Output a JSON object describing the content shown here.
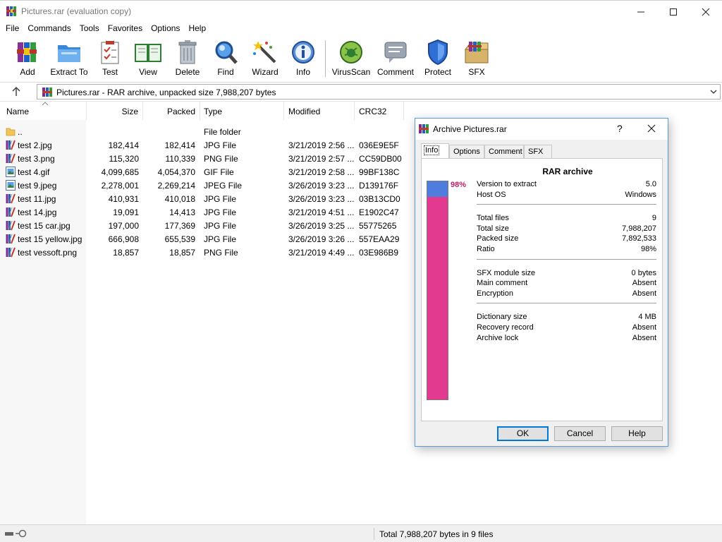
{
  "window": {
    "title": "Pictures.rar (evaluation copy)"
  },
  "menu": [
    "File",
    "Commands",
    "Tools",
    "Favorites",
    "Options",
    "Help"
  ],
  "toolbar": [
    {
      "label": "Add",
      "icon": "add-icon"
    },
    {
      "label": "Extract To",
      "icon": "extract-to-icon"
    },
    {
      "label": "Test",
      "icon": "test-icon"
    },
    {
      "label": "View",
      "icon": "view-icon"
    },
    {
      "label": "Delete",
      "icon": "delete-icon"
    },
    {
      "label": "Find",
      "icon": "find-icon"
    },
    {
      "label": "Wizard",
      "icon": "wizard-icon"
    },
    {
      "label": "Info",
      "icon": "info-icon"
    },
    {
      "label": "VirusScan",
      "icon": "virus-scan-icon"
    },
    {
      "label": "Comment",
      "icon": "comment-icon"
    },
    {
      "label": "Protect",
      "icon": "protect-icon"
    },
    {
      "label": "SFX",
      "icon": "sfx-icon"
    }
  ],
  "address": {
    "text": "Pictures.rar - RAR archive, unpacked size 7,988,207 bytes"
  },
  "columns": {
    "name": "Name",
    "size": "Size",
    "packed": "Packed",
    "type": "Type",
    "modified": "Modified",
    "crc": "CRC32"
  },
  "files": [
    {
      "name": "..",
      "size": "",
      "packed": "",
      "type": "File folder",
      "modified": "",
      "crc": "",
      "kind": "folder"
    },
    {
      "name": "test 2.jpg",
      "size": "182,414",
      "packed": "182,414",
      "type": "JPG File",
      "modified": "3/21/2019 2:56 ...",
      "crc": "036E9E5F",
      "kind": "image-jpg"
    },
    {
      "name": "test 3.png",
      "size": "115,320",
      "packed": "110,339",
      "type": "PNG File",
      "modified": "3/21/2019 2:57 ...",
      "crc": "CC59DB00",
      "kind": "image-jpg"
    },
    {
      "name": "test 4.gif",
      "size": "4,099,685",
      "packed": "4,054,370",
      "type": "GIF File",
      "modified": "3/21/2019 2:58 ...",
      "crc": "99BF138C",
      "kind": "image-photo"
    },
    {
      "name": "test 9.jpeg",
      "size": "2,278,001",
      "packed": "2,269,214",
      "type": "JPEG File",
      "modified": "3/26/2019 3:23 ...",
      "crc": "D139176F",
      "kind": "image-photo"
    },
    {
      "name": "test 11.jpg",
      "size": "410,931",
      "packed": "410,018",
      "type": "JPG File",
      "modified": "3/26/2019 3:23 ...",
      "crc": "03B13CD0",
      "kind": "image-jpg"
    },
    {
      "name": "test 14.jpg",
      "size": "19,091",
      "packed": "14,413",
      "type": "JPG File",
      "modified": "3/21/2019 4:51 ...",
      "crc": "E1902C47",
      "kind": "image-jpg"
    },
    {
      "name": "test 15 car.jpg",
      "size": "197,000",
      "packed": "177,369",
      "type": "JPG File",
      "modified": "3/26/2019 3:25 ...",
      "crc": "55775265",
      "kind": "image-jpg"
    },
    {
      "name": "test 15 yellow.jpg",
      "size": "666,908",
      "packed": "655,539",
      "type": "JPG File",
      "modified": "3/26/2019 3:26 ...",
      "crc": "557EAA29",
      "kind": "image-jpg"
    },
    {
      "name": "test vessoft.png",
      "size": "18,857",
      "packed": "18,857",
      "type": "PNG File",
      "modified": "3/21/2019 4:49 ...",
      "crc": "03E986B9",
      "kind": "image-jpg"
    }
  ],
  "status": {
    "text": "Total 7,988,207 bytes in 9 files"
  },
  "dialog": {
    "title": "Archive Pictures.rar",
    "help_glyph": "?",
    "tabs": [
      "Info",
      "Options",
      "Comment",
      "SFX"
    ],
    "active_tab": "Info",
    "panel_title": "RAR archive",
    "ratio_percent": "98%",
    "ratio_value": 0.98,
    "groups": [
      [
        {
          "label": "Version to extract",
          "value": "5.0"
        },
        {
          "label": "Host OS",
          "value": "Windows"
        }
      ],
      [
        {
          "label": "Total files",
          "value": "9"
        },
        {
          "label": "Total size",
          "value": "7,988,207"
        },
        {
          "label": "Packed size",
          "value": "7,892,533"
        },
        {
          "label": "Ratio",
          "value": "98%"
        }
      ],
      [
        {
          "label": "SFX module size",
          "value": "0 bytes"
        },
        {
          "label": "Main comment",
          "value": "Absent"
        },
        {
          "label": "Encryption",
          "value": "Absent"
        }
      ],
      [
        {
          "label": "Dictionary size",
          "value": "4 MB"
        },
        {
          "label": "Recovery record",
          "value": "Absent"
        },
        {
          "label": "Archive lock",
          "value": "Absent"
        }
      ]
    ],
    "buttons": {
      "ok": "OK",
      "cancel": "Cancel",
      "help": "Help"
    }
  },
  "colors": {
    "ratio_fill": "#e23a8f",
    "ratio_top": "#4f7dde",
    "ratio_text": "#c41e65",
    "default_button_border": "#0078d7"
  }
}
